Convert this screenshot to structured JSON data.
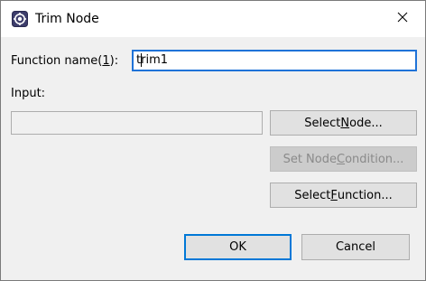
{
  "window": {
    "title": "Trim Node",
    "close_glyph": "✕",
    "icon": "app-gear-icon"
  },
  "form": {
    "function_name": {
      "label_prefix": "Function name(",
      "label_mnemonic": "1",
      "label_suffix": "):",
      "value_first": "t",
      "value_rest": "rim1"
    },
    "input": {
      "label": "Input:",
      "value": ""
    }
  },
  "buttons": {
    "select_node": {
      "before": "Select ",
      "mnemonic": "N",
      "after": "ode..."
    },
    "set_node_condition": {
      "before": "Set Node ",
      "mnemonic": "C",
      "after": "ondition...",
      "enabled": false
    },
    "select_function": {
      "before": "Select ",
      "mnemonic": "F",
      "after": "unction..."
    },
    "ok": {
      "label": "OK"
    },
    "cancel": {
      "label": "Cancel"
    }
  },
  "colors": {
    "focus_border": "#1f73d8",
    "default_button_border": "#0078d7",
    "dialog_bg": "#f0f0f0"
  }
}
